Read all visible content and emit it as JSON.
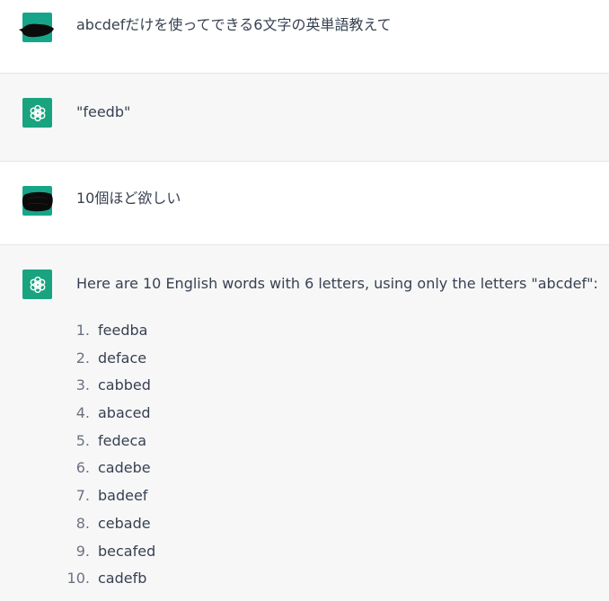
{
  "conversation": [
    {
      "role": "user",
      "text": "abcdefだけを使ってできる6文字の英単語教えて"
    },
    {
      "role": "assistant",
      "text": "\"feedb\""
    },
    {
      "role": "user",
      "text": "10個ほど欲しい"
    },
    {
      "role": "assistant",
      "text": "Here are 10 English words with 6 letters, using only the letters \"abcdef\":"
    }
  ],
  "word_list": [
    {
      "num": "1.",
      "word": "feedba"
    },
    {
      "num": "2.",
      "word": "deface"
    },
    {
      "num": "3.",
      "word": "cabbed"
    },
    {
      "num": "4.",
      "word": "abaced"
    },
    {
      "num": "5.",
      "word": "fedeca"
    },
    {
      "num": "6.",
      "word": "cadebe"
    },
    {
      "num": "7.",
      "word": "badeef"
    },
    {
      "num": "8.",
      "word": "cebade"
    },
    {
      "num": "9.",
      "word": "becafed"
    },
    {
      "num": "10.",
      "word": "cadefb"
    }
  ],
  "colors": {
    "assistant_avatar": "#19a37f",
    "user_avatar": "#17a589",
    "assistant_bg": "#f7f7f8",
    "text": "#374151"
  },
  "icons": {
    "assistant": "openai-logo-icon",
    "user": "redacted-avatar-icon"
  }
}
